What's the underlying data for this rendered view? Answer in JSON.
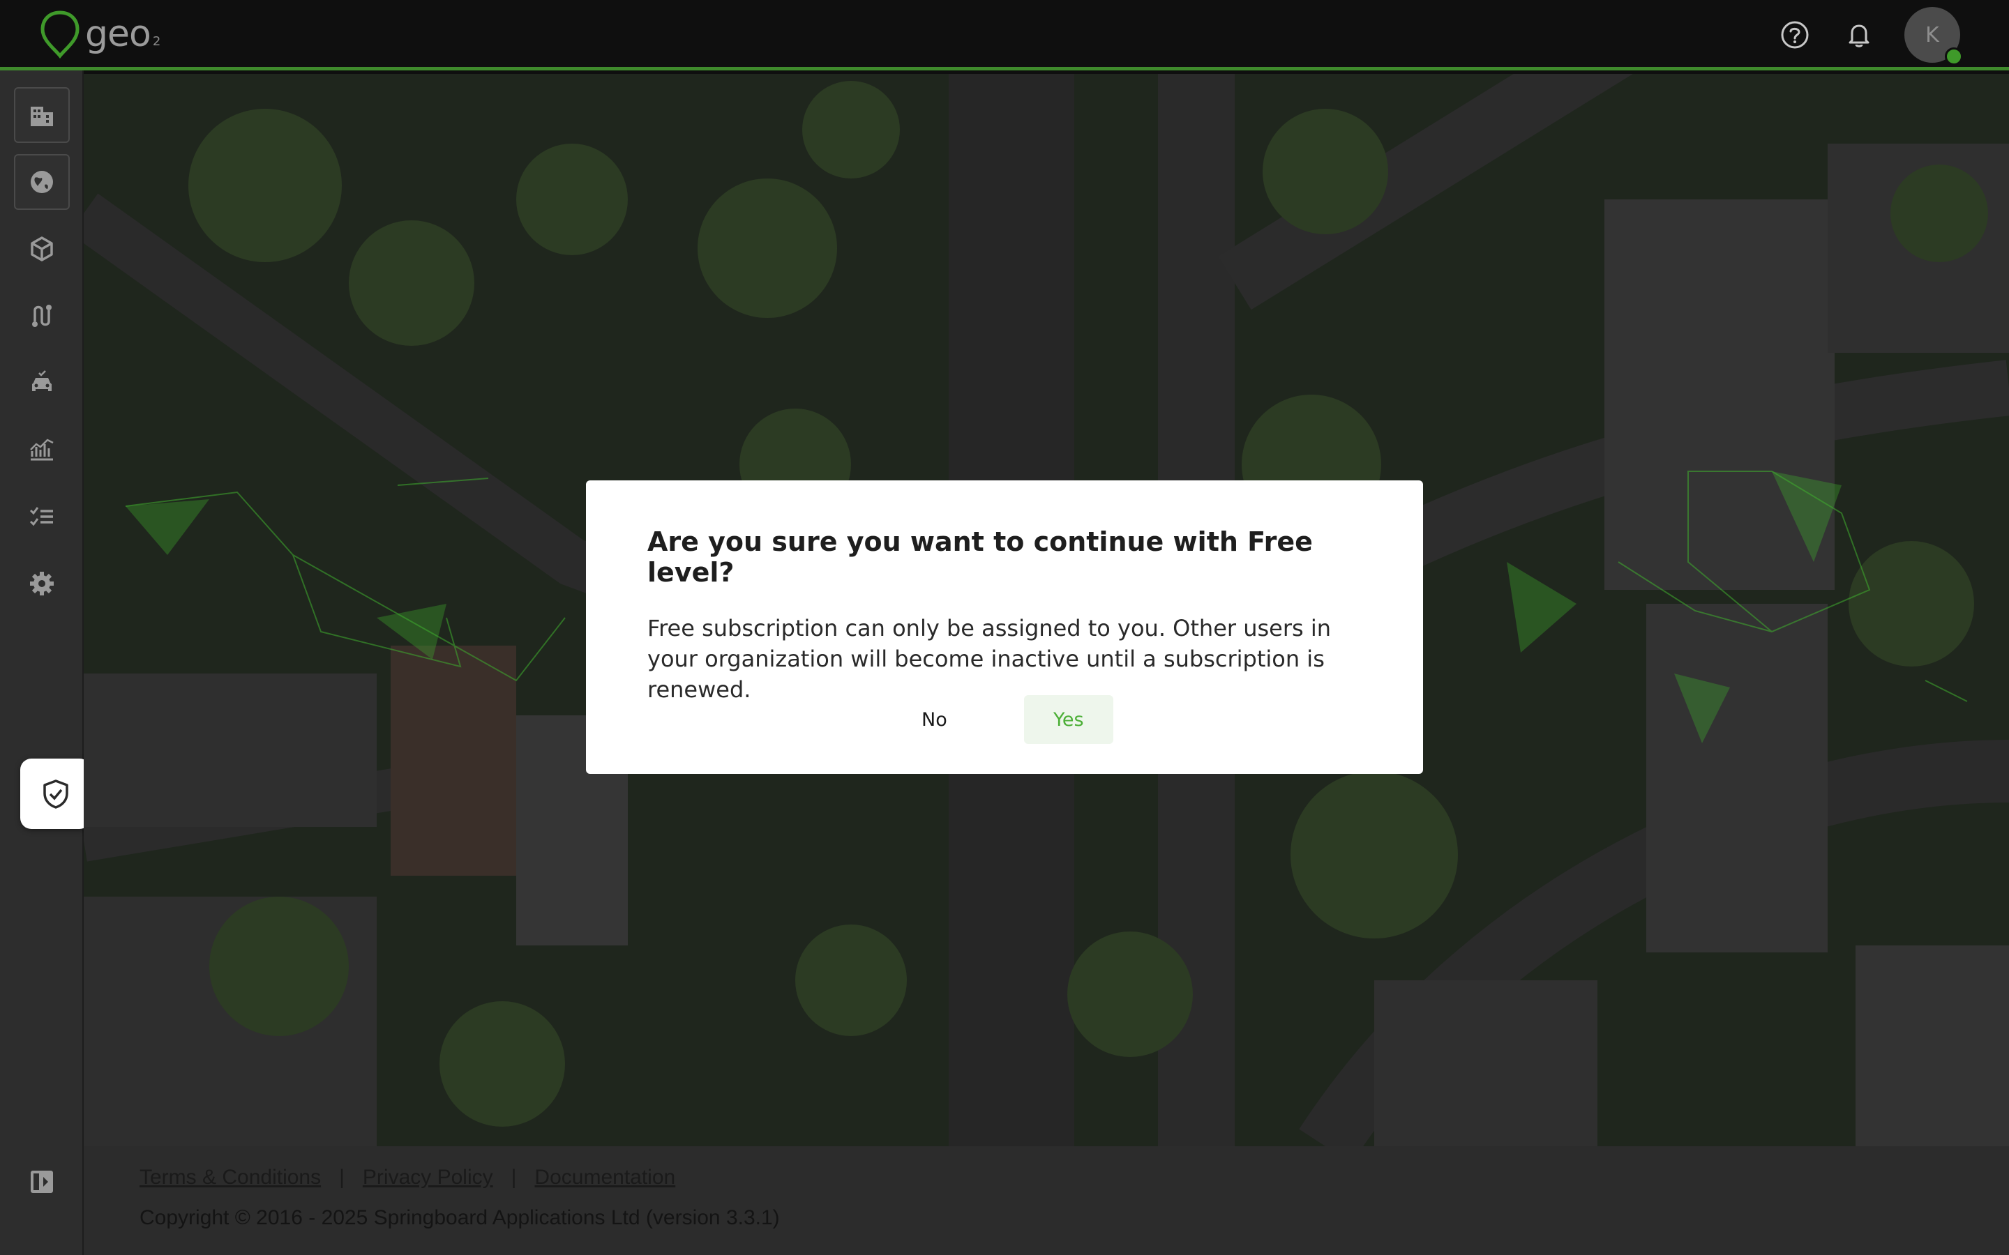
{
  "header": {
    "logo_text": "geo",
    "logo_sub": "2",
    "avatar_initial": "K",
    "icons": [
      "help-circle-icon",
      "bell-icon"
    ]
  },
  "sidebar": {
    "items": [
      {
        "name": "buildings",
        "icon": "building-grid-icon"
      },
      {
        "name": "globe",
        "icon": "globe-icon"
      },
      {
        "name": "packages",
        "icon": "cube-icon"
      },
      {
        "name": "routes",
        "icon": "route-icon"
      },
      {
        "name": "vehicles",
        "icon": "car-check-icon"
      },
      {
        "name": "analytics",
        "icon": "chart-icon"
      },
      {
        "name": "tasks",
        "icon": "checklist-icon"
      },
      {
        "name": "settings",
        "icon": "gear-icon"
      }
    ],
    "floating_button_icon": "shield-check-icon",
    "collapse_icon": "sidebar-collapse-icon"
  },
  "dialog": {
    "title": "Are you sure you want to continue with Free level?",
    "body": "Free subscription can only be assigned to you. Other users in your organization will become inactive until a subscription is renewed.",
    "no_label": "No",
    "yes_label": "Yes"
  },
  "footer": {
    "links": [
      "Terms & Conditions",
      "Privacy Policy",
      "Documentation"
    ],
    "separator": "|",
    "copyright": "Copyright © 2016 - 2025 Springboard Applications Ltd (version 3.3.1)"
  },
  "colors": {
    "accent": "#3f8a2c",
    "yes_text": "#4caf37",
    "topbar": "#0f0f0f",
    "sidebar": "#2d2d2d"
  }
}
